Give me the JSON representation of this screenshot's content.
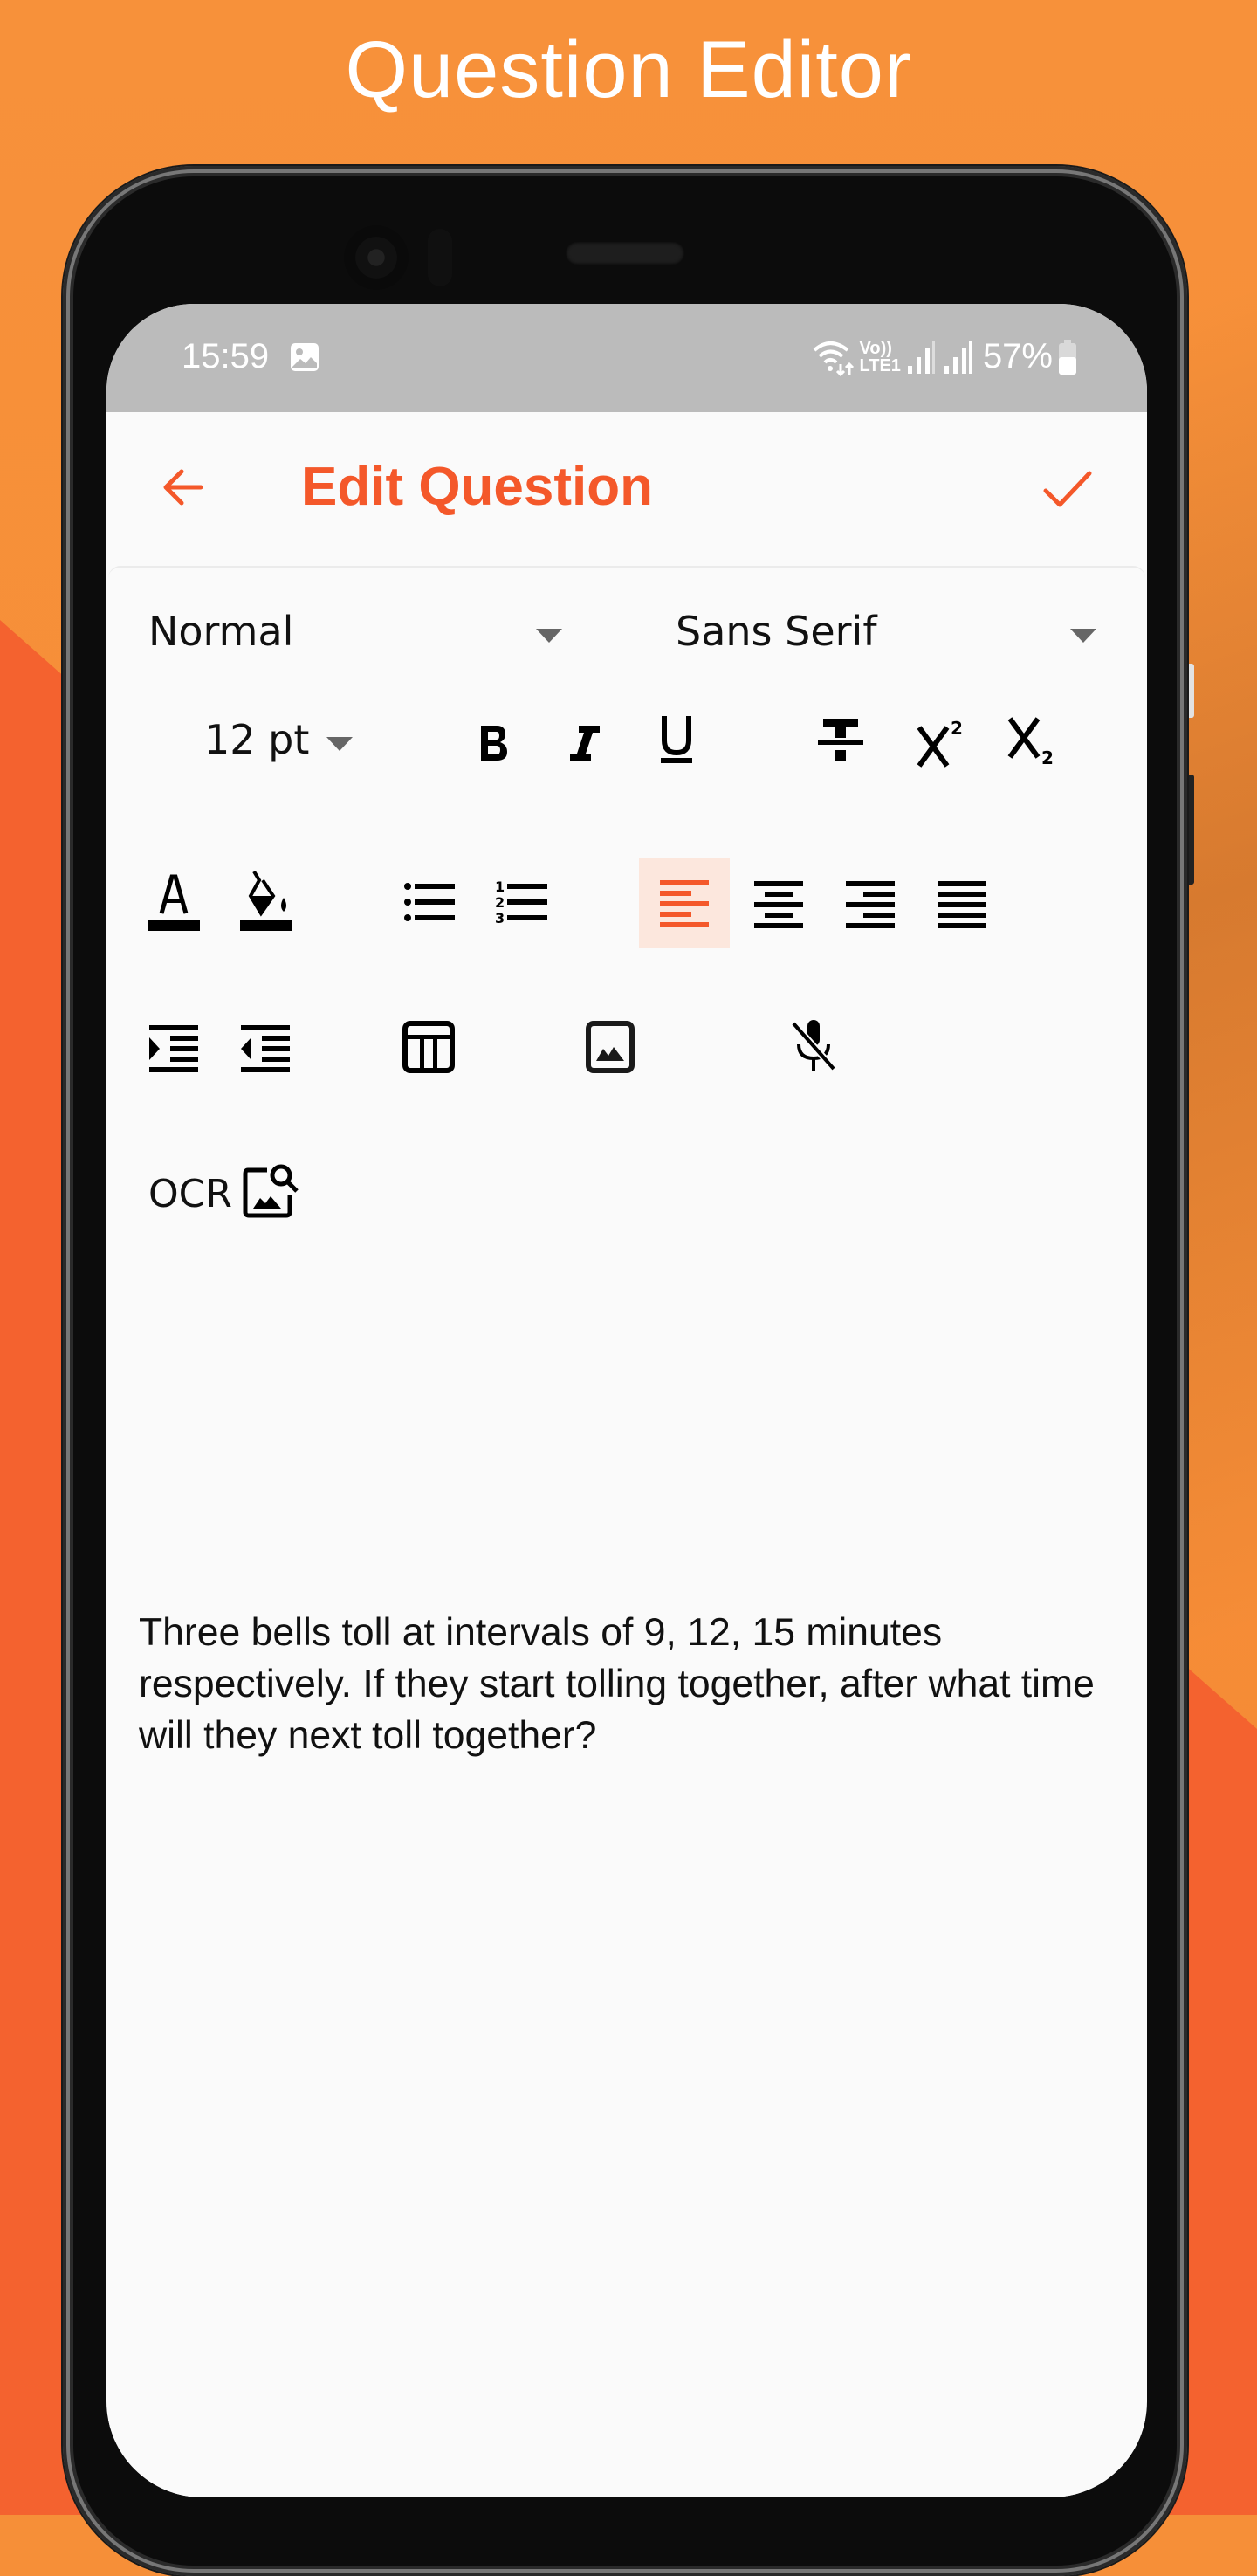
{
  "banner": {
    "title": "Question Editor"
  },
  "status_bar": {
    "time": "15:59",
    "notification_icon": "image-icon",
    "network_label_top": "Vo))",
    "network_label_bottom": "LTE1",
    "battery_percent": "57%",
    "icons": [
      "wifi-icon",
      "volte-icon",
      "signal-icon",
      "signal-icon",
      "battery-icon"
    ]
  },
  "app_bar": {
    "title": "Edit Question",
    "back_icon": "arrow-back-icon",
    "confirm_icon": "check-icon"
  },
  "toolbar": {
    "header_dropdown": {
      "value": "Normal"
    },
    "font_dropdown": {
      "value": "Sans Serif"
    },
    "size_dropdown": {
      "value": "12 pt"
    },
    "format_buttons": [
      "bold",
      "italic",
      "underline",
      "strikethrough",
      "superscript",
      "subscript"
    ],
    "color_buttons": [
      "text-color",
      "background-color"
    ],
    "list_buttons": [
      "bullet-list",
      "numbered-list"
    ],
    "align_buttons": [
      "align-left",
      "align-center",
      "align-right",
      "align-justify"
    ],
    "active_alignment": "align-left",
    "indent_buttons": [
      "indent-increase",
      "indent-decrease"
    ],
    "insert_buttons": [
      "table",
      "image",
      "voice-input-off"
    ],
    "ocr_label": "OCR"
  },
  "editor": {
    "content": "Three bells toll at intervals of 9, 12, 15 minutes respectively. If they start tolling together, after what time will they next toll together?"
  },
  "colors": {
    "accent": "#F4582A",
    "active_bg": "#FCE7DD",
    "bg_top": "#F7913A",
    "bg_bottom": "#F4622F",
    "status_bar": "#BBBBBB"
  }
}
